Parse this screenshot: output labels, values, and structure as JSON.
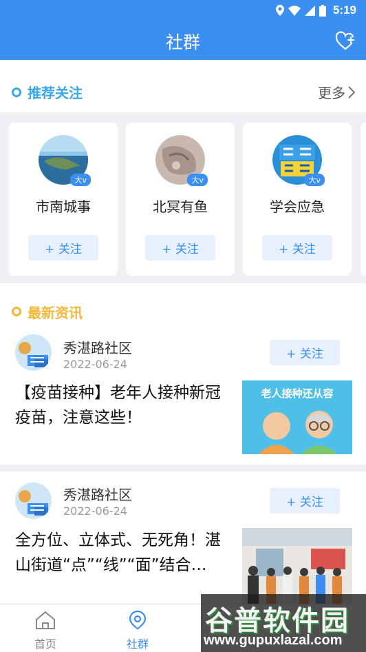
{
  "status_bar": {
    "time": "5:19"
  },
  "app_bar": {
    "title": "社群"
  },
  "recommend": {
    "title": "推荐关注",
    "more_label": "更多",
    "cards": [
      {
        "name": "市南城事",
        "badge": "大v",
        "follow_label": "+ 关注"
      },
      {
        "name": "北冥有鱼",
        "badge": "大v",
        "follow_label": "+ 关注"
      },
      {
        "name": "学会应急",
        "badge": "大v",
        "follow_label": "+ 关注"
      }
    ]
  },
  "news": {
    "title": "最新资讯",
    "articles": [
      {
        "source": "秀湛路社区",
        "date": "2022-06-24",
        "follow_label": "+ 关注",
        "headline": "【疫苗接种】老年人接种新冠疫苗，注意这些！",
        "thumb_caption": "老人接种还从容"
      },
      {
        "source": "秀湛路社区",
        "date": "2022-06-24",
        "follow_label": "+ 关注",
        "headline": "全方位、立体式、无死角！湛山街道“点”“线”“面”结合…"
      }
    ]
  },
  "tab_bar": {
    "tabs": [
      {
        "label": "首页",
        "icon": "home-icon"
      },
      {
        "label": "社群",
        "icon": "location-pin-icon"
      }
    ]
  },
  "watermark": {
    "brand": "谷普软件园",
    "url": "www.gupuxlazal.com"
  },
  "colors": {
    "primary": "#3b8ff0",
    "recommend_accent": "#38a8e6",
    "news_accent": "#f5b73a",
    "follow_bg": "#e6f1fd"
  }
}
